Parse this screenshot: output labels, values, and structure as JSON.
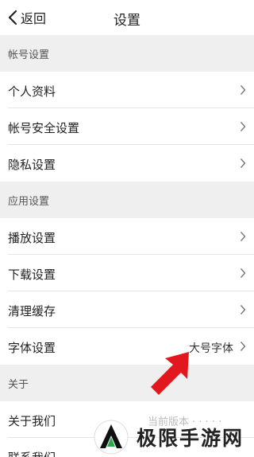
{
  "header": {
    "back_label": "返回",
    "title": "设置"
  },
  "sections": {
    "account": "帐号设置",
    "app": "应用设置",
    "about": "关于"
  },
  "account_items": [
    "个人资料",
    "帐号安全设置",
    "隐私设置"
  ],
  "app_items": [
    "播放设置",
    "下载设置",
    "清理缓存",
    "字体设置"
  ],
  "font_value": "大号字体",
  "about_items": [
    "关于我们",
    "联系我们"
  ],
  "about_value_partial": "当前版本 · · · · ·",
  "watermark": {
    "text": "极限手游网"
  },
  "colors": {
    "arrow": "#e3171e",
    "logo_green": "#2aa84a",
    "background": "#efefef"
  },
  "icons": {
    "back": "chevron-left-icon",
    "row": "chevron-right-icon"
  }
}
